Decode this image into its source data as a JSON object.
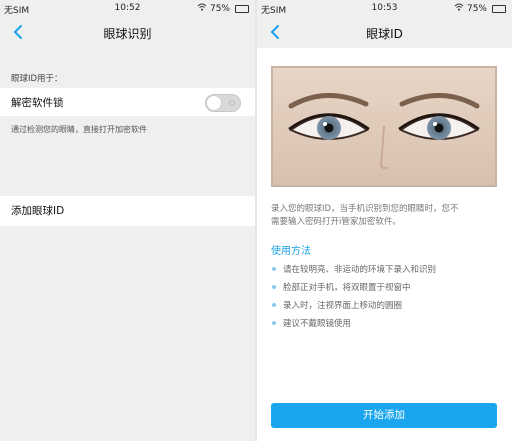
{
  "left": {
    "status": {
      "carrier": "无SIM",
      "time": "10:52",
      "battery": "75%"
    },
    "title": "眼球识别",
    "section_label": "眼球ID用于：",
    "software_lock_label": "解密软件锁",
    "toggle_on": false,
    "description": "通过检测您的眼睛，直接打开加密软件",
    "add_eye_id_label": "添加眼球ID"
  },
  "right": {
    "status": {
      "carrier": "无SIM",
      "time": "10:53",
      "battery": "75%"
    },
    "title": "眼球ID",
    "intro_line1": "录入您的眼球ID，当手机识别到您的眼睛时，您不",
    "intro_line2": "需要输入密码打开i管家加密软件。",
    "howto_title": "使用方法",
    "bullets": [
      "请在较明亮、非运动的环境下录入和识别",
      "脸部正对手机，将双眼置于视窗中",
      "录入时，注视界面上移动的圆圈",
      "建议不戴眼镜使用"
    ],
    "start_button": "开始添加"
  },
  "colors": {
    "accent": "#1aa3e8",
    "button": "#19a6ee",
    "panel_bg": "#efeff0"
  }
}
